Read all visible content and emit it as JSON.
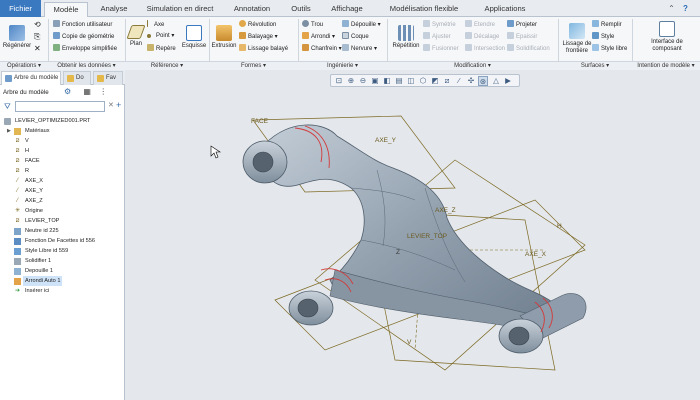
{
  "tabs": [
    {
      "label": "Fichier"
    },
    {
      "label": "Modèle"
    },
    {
      "label": "Analyse"
    },
    {
      "label": "Simulation en direct"
    },
    {
      "label": "Annotation"
    },
    {
      "label": "Outils"
    },
    {
      "label": "Affichage"
    },
    {
      "label": "Modélisation flexible"
    },
    {
      "label": "Applications"
    }
  ],
  "ribbon": {
    "operations": {
      "label": "Opérations ▾",
      "regen": "Régénérer"
    },
    "data": {
      "label": "Obtenir les données ▾",
      "items": [
        "Fonction utilisateur",
        "Copie de géométrie",
        "Enveloppe simplifiée"
      ]
    },
    "reference": {
      "label": "Référence ▾",
      "plan": "Plan",
      "items": [
        "Axe",
        "Point ▾",
        "Repère"
      ],
      "sketch": "Esquisse"
    },
    "shapes": {
      "label": "Formes ▾",
      "extrude": "Extrusion",
      "items": [
        "Révolution",
        "Balayage ▾",
        "Lissage balayé"
      ]
    },
    "engineering": {
      "label": "Ingénierie ▾",
      "col1": [
        "Trou",
        "Arrondi ▾",
        "Chanfrein ▾"
      ],
      "col2": [
        "Dépouille ▾",
        "Coque",
        "Nervure ▾"
      ]
    },
    "modification": {
      "label": "Modification ▾",
      "repeat": "Répétition",
      "col1": [
        "Symétrie",
        "Ajuster",
        "Fusionner"
      ],
      "col2": [
        "Etendre",
        "Décalage",
        "Intersection"
      ],
      "col3": [
        "Projeter",
        "Epaissir",
        "Solidification"
      ]
    },
    "surfaces": {
      "label": "Surfaces ▾",
      "lissage": "Lissage de frontière",
      "items": [
        "Remplir",
        "Style",
        "Style libre"
      ]
    },
    "intent": {
      "label": "Intention de modèle ▾",
      "component": "Interface de composant"
    }
  },
  "panel": {
    "tabs": [
      {
        "label": "Arbre du modèle"
      },
      {
        "label": "Do"
      },
      {
        "label": "Fav"
      }
    ],
    "title": "Arbre du modèle",
    "filter_value": "",
    "root": "LEVIER_OPTIMIZED001.PRT",
    "items": [
      {
        "label": "Matériaux",
        "icon": "folder-icon"
      },
      {
        "label": "V",
        "icon": "datum-plane-icon"
      },
      {
        "label": "H",
        "icon": "datum-plane-icon"
      },
      {
        "label": "FACE",
        "icon": "datum-plane-icon"
      },
      {
        "label": "R",
        "icon": "datum-plane-icon"
      },
      {
        "label": "AXE_X",
        "icon": "datum-axis-icon"
      },
      {
        "label": "AXE_Y",
        "icon": "datum-axis-icon"
      },
      {
        "label": "AXE_Z",
        "icon": "datum-axis-icon"
      },
      {
        "label": "Origine",
        "icon": "datum-point-icon"
      },
      {
        "label": "LEVIER_TOP",
        "icon": "datum-plane-icon"
      },
      {
        "label": "Neutre id 225",
        "icon": "feature-icon"
      },
      {
        "label": "Fonction De Facettes id 556",
        "icon": "feature-icon"
      },
      {
        "label": "Style Libre id 559",
        "icon": "feature-icon"
      },
      {
        "label": "Solidifier 1",
        "icon": "solidify-icon"
      },
      {
        "label": "Depouille 1",
        "icon": "draft-icon"
      },
      {
        "label": "Arrondi Auto 1",
        "icon": "round-icon"
      },
      {
        "label": "Insérer ici",
        "icon": "insert-arrow-icon"
      }
    ]
  },
  "viewport": {
    "labels": {
      "face": "FACE",
      "axe_y": "AXE_Y",
      "axe_z": "AXE_Z",
      "levier_top": "LEVIER_TOP",
      "axe_x": "AXE_X",
      "h": "H",
      "v": "V",
      "z": "Z"
    }
  },
  "colors": {
    "file_tab": "#3a78c0",
    "selection": "#cfe3f8",
    "datum": "#7d6a25",
    "part": "#9aa7b4",
    "edge_red": "#d43a3a"
  }
}
